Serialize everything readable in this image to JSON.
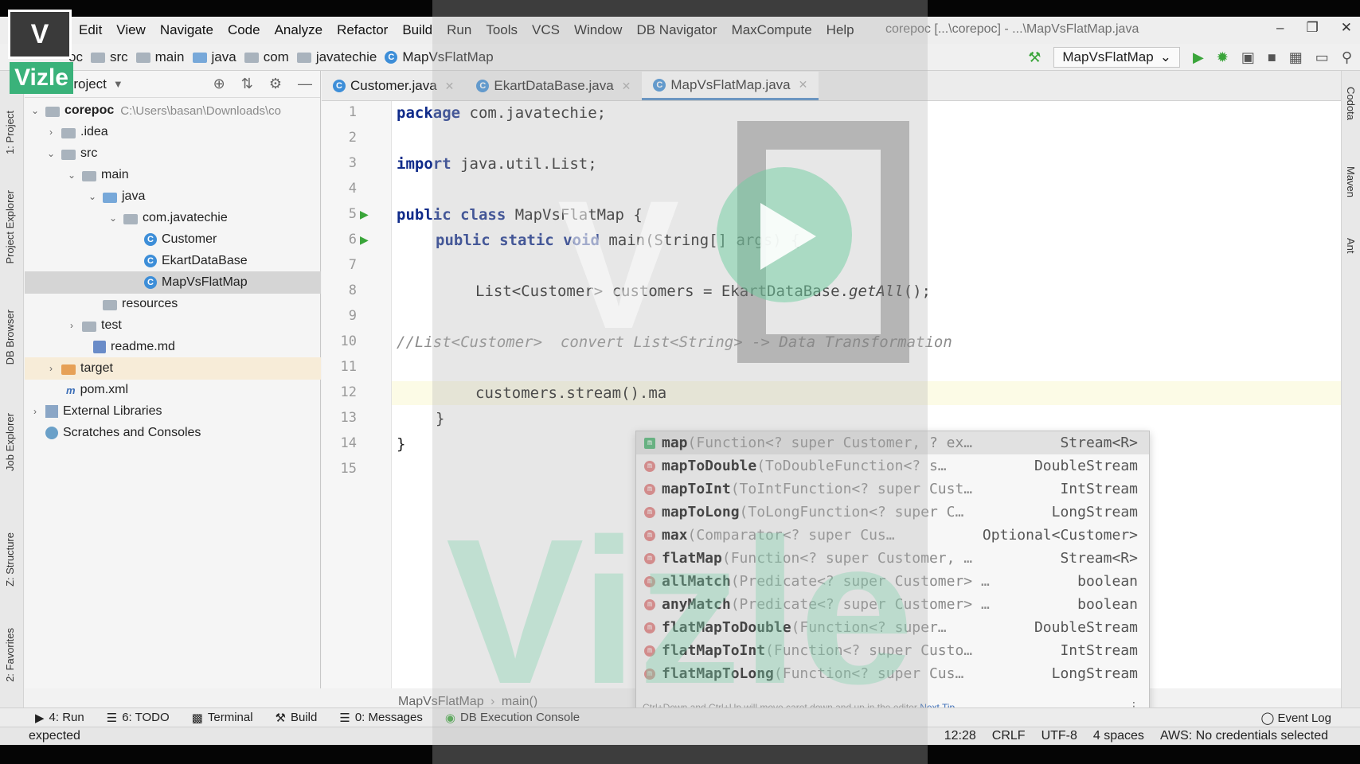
{
  "menu": [
    "Edit",
    "View",
    "Navigate",
    "Code",
    "Analyze",
    "Refactor",
    "Build",
    "Run",
    "Tools",
    "VCS",
    "Window",
    "DB Navigator",
    "MaxCompute",
    "Help"
  ],
  "window_title": "corepoc [...\\corepoc] - ...\\MapVsFlatMap.java",
  "navbar": {
    "crumbs": [
      "oc",
      "src",
      "main",
      "java",
      "com",
      "javatechie",
      "MapVsFlatMap"
    ],
    "run_config": "MapVsFlatMap"
  },
  "left_tabs": [
    "1: Project",
    "Project Explorer",
    "DB Browser",
    "Job Explorer",
    "Z: Structure",
    "2: Favorites"
  ],
  "right_tabs": [
    "Codota",
    "Maven",
    "Ant"
  ],
  "project": {
    "header": "Project",
    "root_name": "corepoc",
    "root_path": "C:\\Users\\basan\\Downloads\\co",
    "items": [
      {
        "label": ".idea"
      },
      {
        "label": "src"
      },
      {
        "label": "main"
      },
      {
        "label": "java"
      },
      {
        "label": "com.javatechie"
      },
      {
        "label": "Customer"
      },
      {
        "label": "EkartDataBase"
      },
      {
        "label": "MapVsFlatMap"
      },
      {
        "label": "resources"
      },
      {
        "label": "test"
      },
      {
        "label": "readme.md"
      },
      {
        "label": "target"
      },
      {
        "label": "pom.xml"
      },
      {
        "label": "External Libraries"
      },
      {
        "label": "Scratches and Consoles"
      }
    ]
  },
  "tabs": [
    "Customer.java",
    "EkartDataBase.java",
    "MapVsFlatMap.java"
  ],
  "active_tab": "MapVsFlatMap.java",
  "code": {
    "line_numbers": [
      "1",
      "2",
      "3",
      "4",
      "5",
      "6",
      "7",
      "8",
      "9",
      "10",
      "11",
      "12",
      "13",
      "14",
      "15"
    ],
    "l1_kw": "package",
    "l1_rest": " com.javatechie;",
    "l3_kw": "import",
    "l3_rest": " java.util.List;",
    "l5_kw": "public class",
    "l5_rest": " MapVsFlatMap {",
    "l6_kw": "public static void",
    "l6_rest": " main(String[] args) {",
    "l8_a": "List<Customer> customers = EkartDataBase.",
    "l8_fn": "getAll",
    "l8_b": "();",
    "l10": "//List<Customer>  convert List<String> -> Data Transformation",
    "l12": "customers.stream().ma",
    "l13": "}",
    "l14": "}"
  },
  "editor_breadcrumb": {
    "cls": "MapVsFlatMap",
    "method": "main()"
  },
  "suggestions": [
    {
      "name": "map",
      "sig": "(Function<? super Customer, ? ex…",
      "ret": "Stream<R>"
    },
    {
      "name": "mapToDouble",
      "sig": "(ToDoubleFunction<? s…",
      "ret": "DoubleStream"
    },
    {
      "name": "mapToInt",
      "sig": "(ToIntFunction<? super Cust…",
      "ret": "IntStream"
    },
    {
      "name": "mapToLong",
      "sig": "(ToLongFunction<? super C…",
      "ret": "LongStream"
    },
    {
      "name": "max",
      "sig": "(Comparator<? super Cus…",
      "ret": "Optional<Customer>"
    },
    {
      "name": "flatMap",
      "sig": "(Function<? super Customer, …",
      "ret": "Stream<R>"
    },
    {
      "name": "allMatch",
      "sig": "(Predicate<? super Customer> …",
      "ret": "boolean"
    },
    {
      "name": "anyMatch",
      "sig": "(Predicate<? super Customer> …",
      "ret": "boolean"
    },
    {
      "name": "flatMapToDouble",
      "sig": "(Function<? super…",
      "ret": "DoubleStream"
    },
    {
      "name": "flatMapToInt",
      "sig": "(Function<? super Custo…",
      "ret": "IntStream"
    },
    {
      "name": "flatMapToLong",
      "sig": "(Function<? super Cus…",
      "ret": "LongStream"
    }
  ],
  "popup_hint": "Ctrl+Down and Ctrl+Up will move caret down and up in the editor",
  "popup_next_tip": "Next Tip",
  "bottom_tools": [
    "4: Run",
    "6: TODO",
    "Terminal",
    "Build",
    "0: Messages",
    "DB Execution Console"
  ],
  "event_log": "Event Log",
  "status": {
    "left": "expected",
    "position": "12:28",
    "line_sep": "CRLF",
    "encoding": "UTF-8",
    "indent": "4 spaces",
    "aws": "AWS: No credentials selected"
  },
  "watermark": {
    "logo_mark": "V",
    "brand": "Vizle"
  }
}
